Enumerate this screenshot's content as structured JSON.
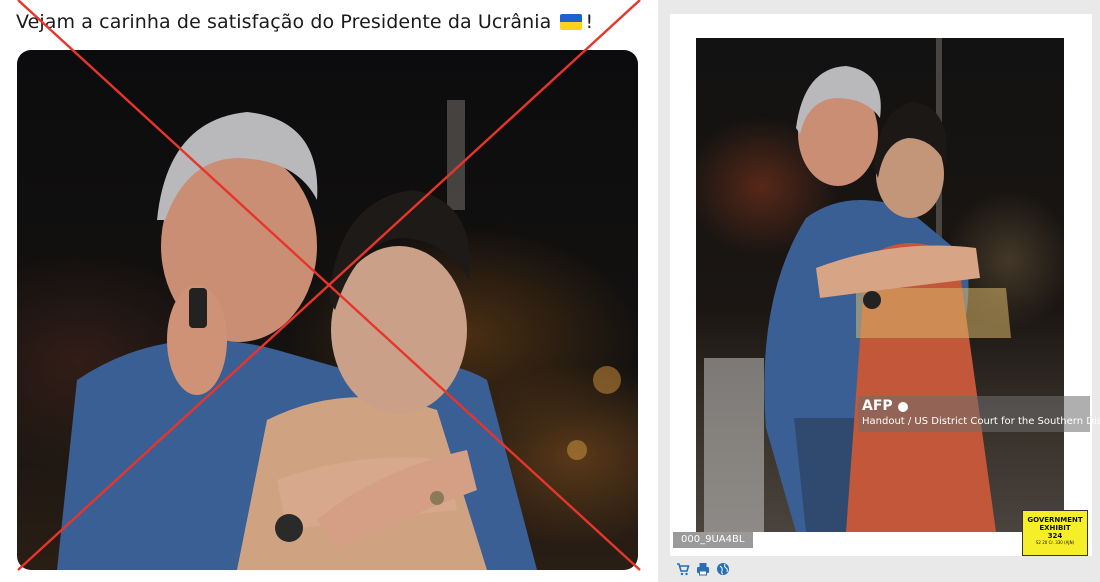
{
  "post": {
    "text": "Vejam a carinha de satisfação do Presidente da Ucrânia",
    "suffix": "!",
    "flag_icon": "ukraine-flag-icon"
  },
  "left_image": {
    "overlay": "red-x-cross",
    "overlay_color": "#e8352b"
  },
  "right_image": {
    "agency_logo": "AFP",
    "caption": "Handout / US District Court for the Southern Distric",
    "image_id": "000_9UA4BL",
    "exhibit": {
      "line1": "GOVERNMENT",
      "line2": "EXHIBIT",
      "line3": "324",
      "small": "S2 20 Cr. 330 (AJN)"
    }
  },
  "toolbar": {
    "icons": [
      "cart-icon",
      "print-icon",
      "globe-icon"
    ],
    "accent": "#2a6fb5"
  },
  "colors": {
    "panel_bg": "#e9e9ea",
    "exhibit_bg": "#f7ee2a"
  }
}
